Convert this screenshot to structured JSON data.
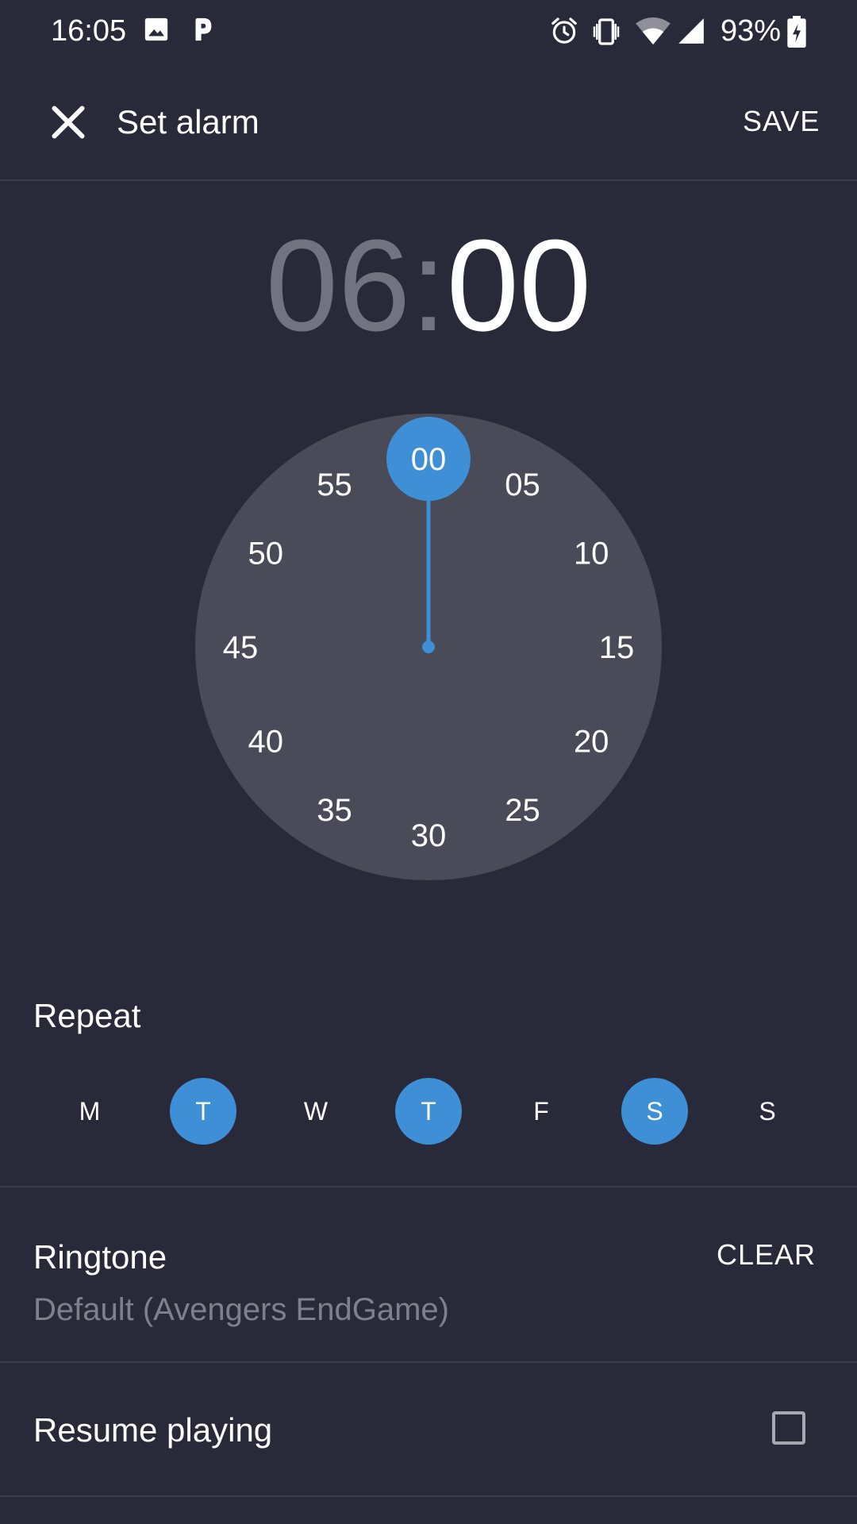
{
  "status_bar": {
    "time": "16:05",
    "battery": "93%",
    "icons": [
      "image-icon",
      "p-app-icon",
      "alarm-icon",
      "vibrate-icon",
      "wifi-icon",
      "signal-icon",
      "battery-charging-icon"
    ]
  },
  "app_bar": {
    "title": "Set alarm",
    "save_label": "SAVE",
    "close_icon": "close-icon"
  },
  "time": {
    "hours": "06",
    "separator": ":",
    "minutes": "00"
  },
  "clock": {
    "mode": "minutes",
    "selected": "00",
    "labels": [
      "00",
      "05",
      "10",
      "15",
      "20",
      "25",
      "30",
      "35",
      "40",
      "45",
      "50",
      "55"
    ],
    "accent_color": "#3f8fd6",
    "face_color": "#4a4b58"
  },
  "repeat": {
    "label": "Repeat",
    "days": [
      {
        "label": "M",
        "selected": false
      },
      {
        "label": "T",
        "selected": true
      },
      {
        "label": "W",
        "selected": false
      },
      {
        "label": "T",
        "selected": true
      },
      {
        "label": "F",
        "selected": false
      },
      {
        "label": "S",
        "selected": true
      },
      {
        "label": "S",
        "selected": false
      }
    ]
  },
  "ringtone": {
    "label": "Ringtone",
    "value": "Default (Avengers EndGame)",
    "clear_label": "CLEAR"
  },
  "resume_playing": {
    "label": "Resume playing",
    "checked": false
  }
}
